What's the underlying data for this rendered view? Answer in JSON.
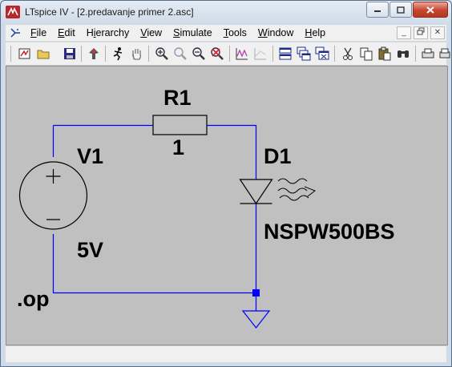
{
  "window": {
    "title": "LTspice IV - [2.predavanje primer 2.asc]"
  },
  "menu": {
    "items": [
      {
        "id": "file",
        "label": "File",
        "accel": "F",
        "rest": "ile"
      },
      {
        "id": "edit",
        "label": "Edit",
        "accel": "E",
        "rest": "dit"
      },
      {
        "id": "hierarchy",
        "label": "Hierarchy",
        "accel": "i",
        "pre": "H",
        "rest": "erarchy"
      },
      {
        "id": "view",
        "label": "View",
        "accel": "V",
        "rest": "iew"
      },
      {
        "id": "simulate",
        "label": "Simulate",
        "accel": "S",
        "rest": "imulate"
      },
      {
        "id": "tools",
        "label": "Tools",
        "accel": "T",
        "rest": "ools"
      },
      {
        "id": "window",
        "label": "Window",
        "accel": "W",
        "rest": "indow"
      },
      {
        "id": "help",
        "label": "Help",
        "accel": "H",
        "rest": "elp"
      }
    ]
  },
  "toolbar": {
    "icons": [
      "run-icon",
      "open-icon",
      "save-icon",
      "control-panel-icon",
      "run-simulation-icon",
      "pan-hand-icon",
      "zoom-in-icon",
      "zoom-full-icon",
      "zoom-out-icon",
      "zoom-cancel-icon",
      "waveform-autorange-icon",
      "waveform-grid-icon",
      "tile-horizontal-icon",
      "cascade-icon",
      "close-windows-icon",
      "cut-icon",
      "copy-icon",
      "paste-icon",
      "find-icon",
      "print-preview-icon",
      "print-icon"
    ]
  },
  "schematic": {
    "resistor": {
      "name": "R1",
      "value": "1"
    },
    "source": {
      "name": "V1",
      "value": "5V"
    },
    "diode": {
      "name": "D1",
      "value": "NSPW500BS"
    },
    "directive": ".op",
    "colors": {
      "wire": "#0000ff",
      "component": "#0000ff",
      "label": "#000000",
      "background": "#c0c0c0",
      "junction": "#0000ff"
    }
  }
}
